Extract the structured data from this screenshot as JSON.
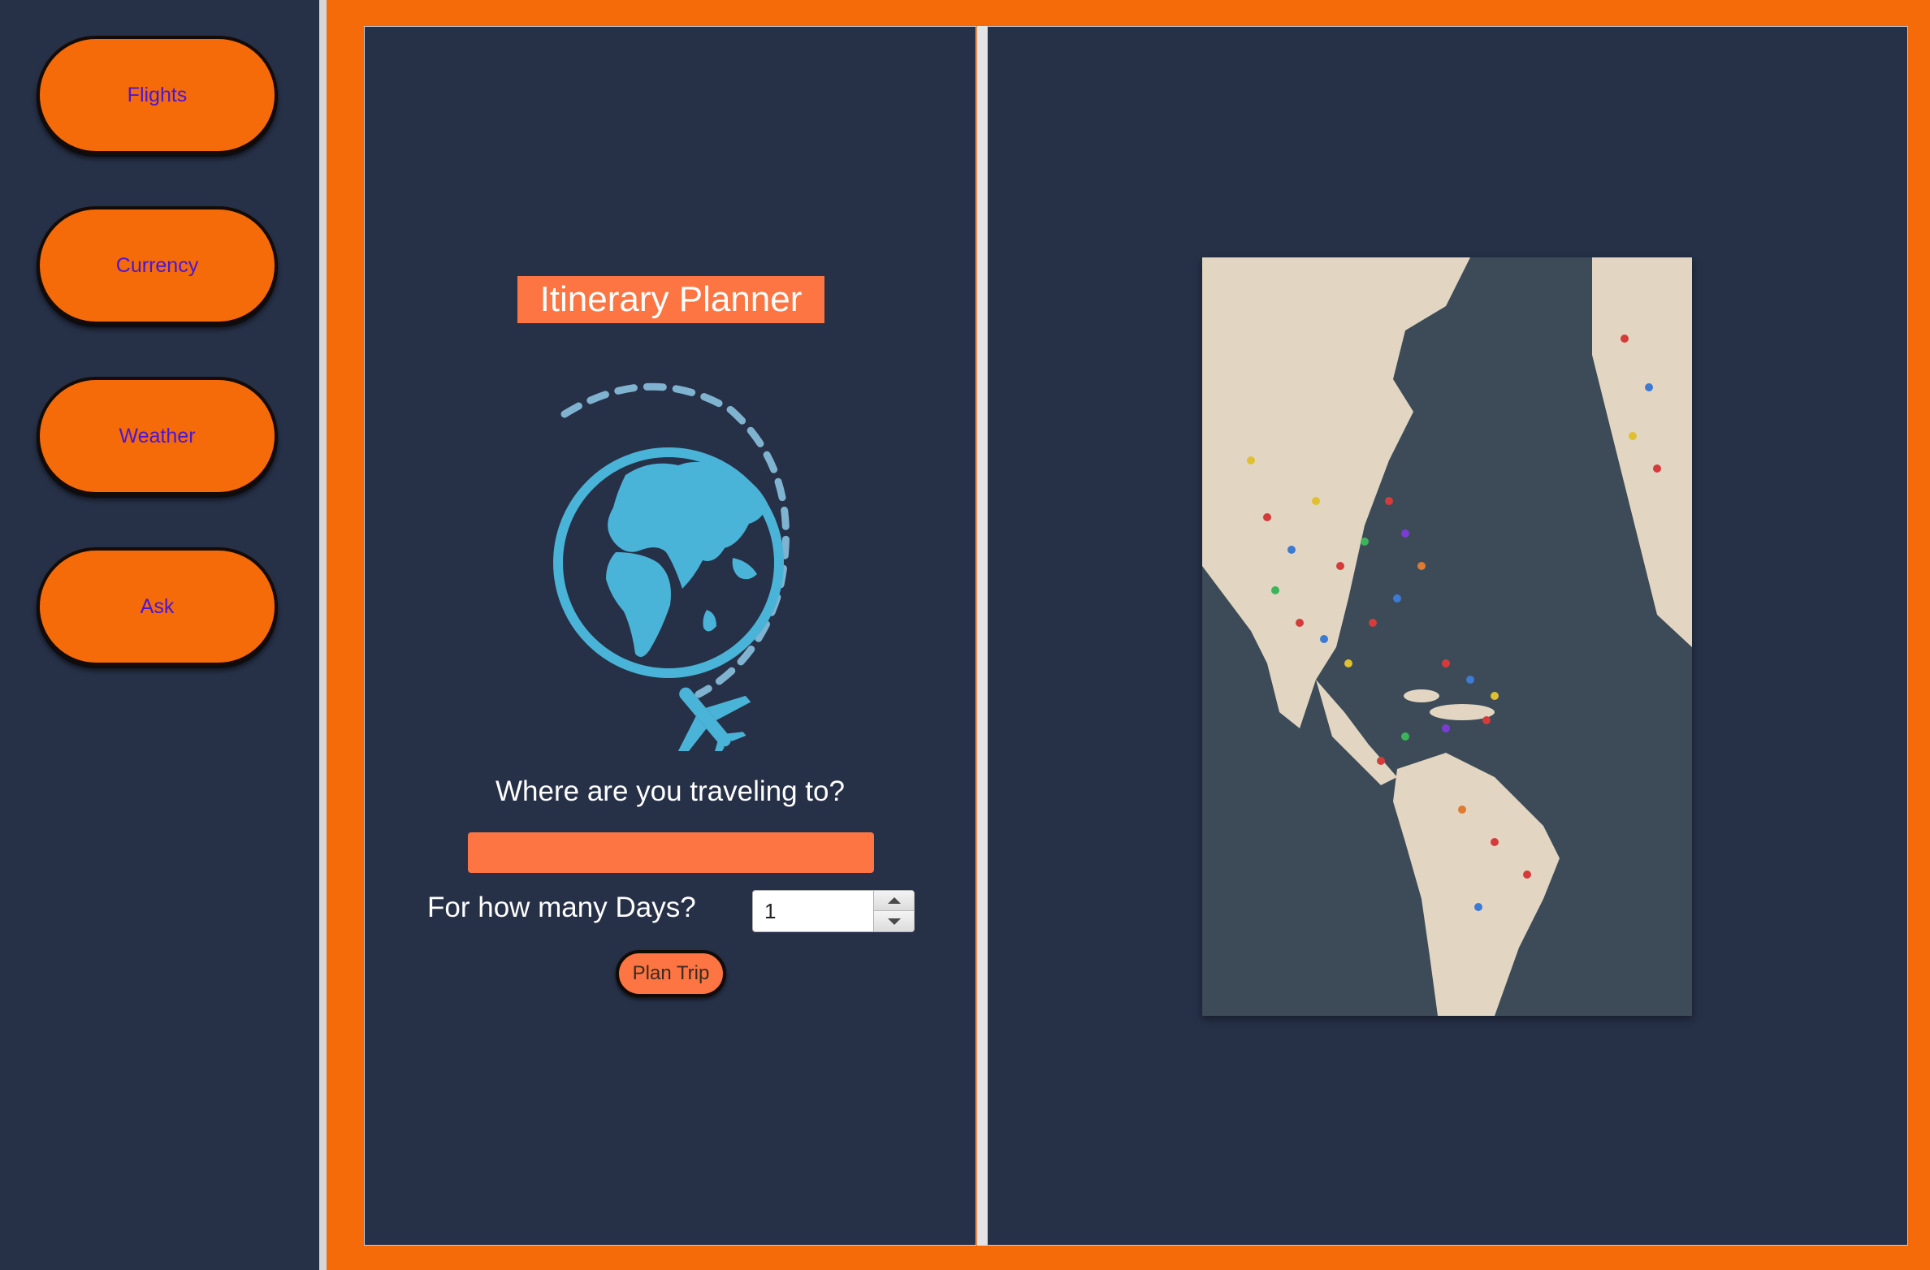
{
  "sidebar": {
    "items": [
      {
        "label": "Flights"
      },
      {
        "label": "Currency"
      },
      {
        "label": "Weather"
      },
      {
        "label": "Ask"
      }
    ]
  },
  "planner": {
    "title": "Itinerary Planner",
    "destination_question": "Where are you traveling to?",
    "destination_value": "",
    "days_label": "For how many Days?",
    "days_value": "1",
    "plan_button": "Plan Trip"
  },
  "icons": {
    "logo": "globe-airplane-icon",
    "spinner_up": "triangle-up-icon",
    "spinner_down": "triangle-down-icon"
  },
  "map_image": {
    "description_icon": "world-map-pins-image"
  },
  "colors": {
    "background": "#263047",
    "accent": "#f56b0a",
    "title_bg": "#fc7543",
    "nav_text": "#4a16d6",
    "logo": "#4ab3d8"
  }
}
